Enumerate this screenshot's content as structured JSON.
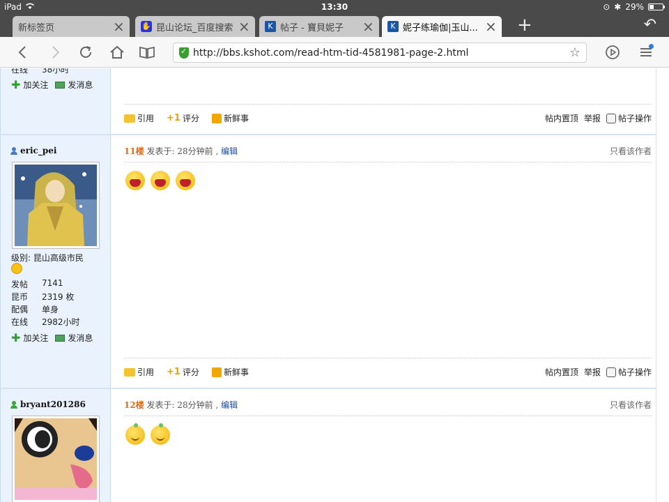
{
  "status_bar": {
    "device": "iPad",
    "time": "13:30",
    "battery": "29%"
  },
  "tabs": [
    {
      "title": "新标签页",
      "favicon": "page-icon"
    },
    {
      "title": "昆山论坛_百度搜索",
      "favicon": "baidu-icon"
    },
    {
      "title": "帖子 - 寶貝妮子",
      "favicon": "site-icon"
    },
    {
      "title": "妮子练瑜伽|玉山...",
      "favicon": "site-icon",
      "active": true
    }
  ],
  "toolbar": {
    "url": "http://bbs.kshot.com/read-htm-tid-4581981-page-2.html"
  },
  "top_partial": {
    "online_label": "在线",
    "online_value": "38小时",
    "follow": "加关注",
    "message": "发消息",
    "footer": {
      "quote": "引用",
      "rate": "评分",
      "news": "新鲜事",
      "pin": "帖内置顶",
      "report": "举报",
      "ops": "帖子操作"
    }
  },
  "posts": [
    {
      "username": "eric_pei",
      "level_label": "级别:",
      "level": "昆山高级市民",
      "stats": [
        {
          "k": "发帖",
          "v": "7141"
        },
        {
          "k": "昆币",
          "v": "2319 枚"
        },
        {
          "k": "配偶",
          "v": "单身"
        },
        {
          "k": "在线",
          "v": "2982小时"
        }
      ],
      "follow": "加关注",
      "message": "发消息",
      "floor": "11楼",
      "posted_label": "发表于: 28分钟前 ,",
      "edit": "编辑",
      "only_author": "只看该作者",
      "emojis": [
        "laugh",
        "laugh",
        "laugh"
      ],
      "footer": {
        "quote": "引用",
        "rate": "评分",
        "news": "新鲜事",
        "pin": "帖内置顶",
        "report": "举报",
        "ops": "帖子操作"
      }
    },
    {
      "username": "bryant201286",
      "floor": "12楼",
      "posted_label": "发表于: 28分钟前 ,",
      "edit": "编辑",
      "only_author": "只看该作者",
      "emojis": [
        "smile",
        "smile"
      ]
    }
  ],
  "colors": {
    "floor": "#e06a1a",
    "edit_link": "#1a4fa0",
    "sidebar_bg": "#eaf3fd",
    "secure": "#3a9d2f"
  }
}
